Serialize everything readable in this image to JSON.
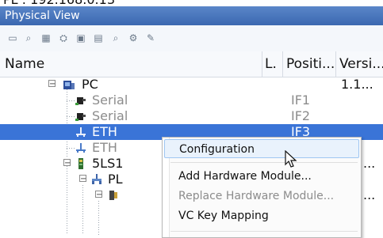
{
  "top_text": "PL : 192.168.0.13",
  "panel_title": "Physical View",
  "toolbar": {
    "icons": [
      "doc-icon",
      "search-icon",
      "color-palette-icon",
      "chip-icon",
      "device-icon",
      "module-icon",
      "find-icon",
      "gear-icon",
      "tools-icon"
    ]
  },
  "columns": {
    "name": "Name",
    "l": "L.",
    "position": "Positi...",
    "version": "Versi..."
  },
  "tree": [
    {
      "name": "PC",
      "position": "",
      "version": "1.1...",
      "expander": "−",
      "icon": "pc-icon",
      "disabled": false,
      "selected": false
    },
    {
      "name": "Serial",
      "position": "IF1",
      "version": "",
      "expander": "",
      "icon": "serial-port-icon",
      "disabled": true,
      "selected": false
    },
    {
      "name": "Serial",
      "position": "IF2",
      "version": "",
      "expander": "",
      "icon": "serial-port-icon",
      "disabled": true,
      "selected": false
    },
    {
      "name": "ETH",
      "position": "IF3",
      "version": "",
      "expander": "",
      "icon": "network-icon",
      "disabled": false,
      "selected": true
    },
    {
      "name": "ETH",
      "position": "",
      "version": "",
      "expander": "",
      "icon": "network-icon",
      "disabled": true,
      "selected": false
    },
    {
      "name": "5LS1",
      "position": "",
      "version": "...",
      "expander": "−",
      "icon": "hardware-module-icon",
      "disabled": false,
      "selected": false
    },
    {
      "name": "PL",
      "position": "",
      "version": "",
      "expander": "−",
      "icon": "powerlink-icon",
      "disabled": false,
      "selected": false
    },
    {
      "name": "",
      "position": "",
      "version": "...",
      "expander": "−",
      "icon": "device-icon",
      "disabled": false,
      "selected": false
    }
  ],
  "context_menu": {
    "items": [
      {
        "label": "Configuration",
        "state": "hover"
      },
      {
        "label": "Add Hardware Module...",
        "state": "normal"
      },
      {
        "label": "Replace Hardware Module...",
        "state": "disabled"
      },
      {
        "label": "VC Key Mapping",
        "state": "normal"
      }
    ]
  },
  "colors": {
    "title_bar": "#3b68b0",
    "selection": "#3a74d7",
    "menu_hover": "#e9f2fc"
  }
}
